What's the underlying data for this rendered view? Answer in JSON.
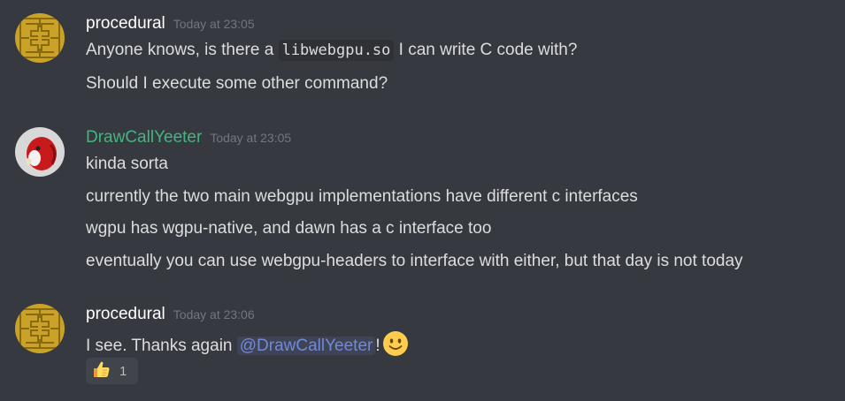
{
  "messages": [
    {
      "username": "procedural",
      "timestamp": "Today at 23:05",
      "line1_before": "Anyone knows, is there a ",
      "line1_code": "libwebgpu.so",
      "line1_after": " I can write C code with?",
      "line2": "Should I execute some other command?"
    },
    {
      "username": "DrawCallYeeter",
      "timestamp": "Today at 23:05",
      "lines": [
        "kinda sorta",
        "currently the two main webgpu implementations have different c interfaces",
        "wgpu has wgpu-native, and dawn has a c interface too",
        "eventually you can use webgpu-headers to interface with either, but that day is not today"
      ]
    },
    {
      "username": "procedural",
      "timestamp": "Today at 23:06",
      "text_before": "I see. Thanks again ",
      "mention": "@DrawCallYeeter",
      "text_after": "!",
      "reaction": {
        "emoji": "thumbs-up",
        "count": "1"
      }
    }
  ],
  "colors": {
    "background": "#36393f",
    "username_default": "#ffffff",
    "username_green": "#43b581",
    "mention": "#7289da"
  }
}
